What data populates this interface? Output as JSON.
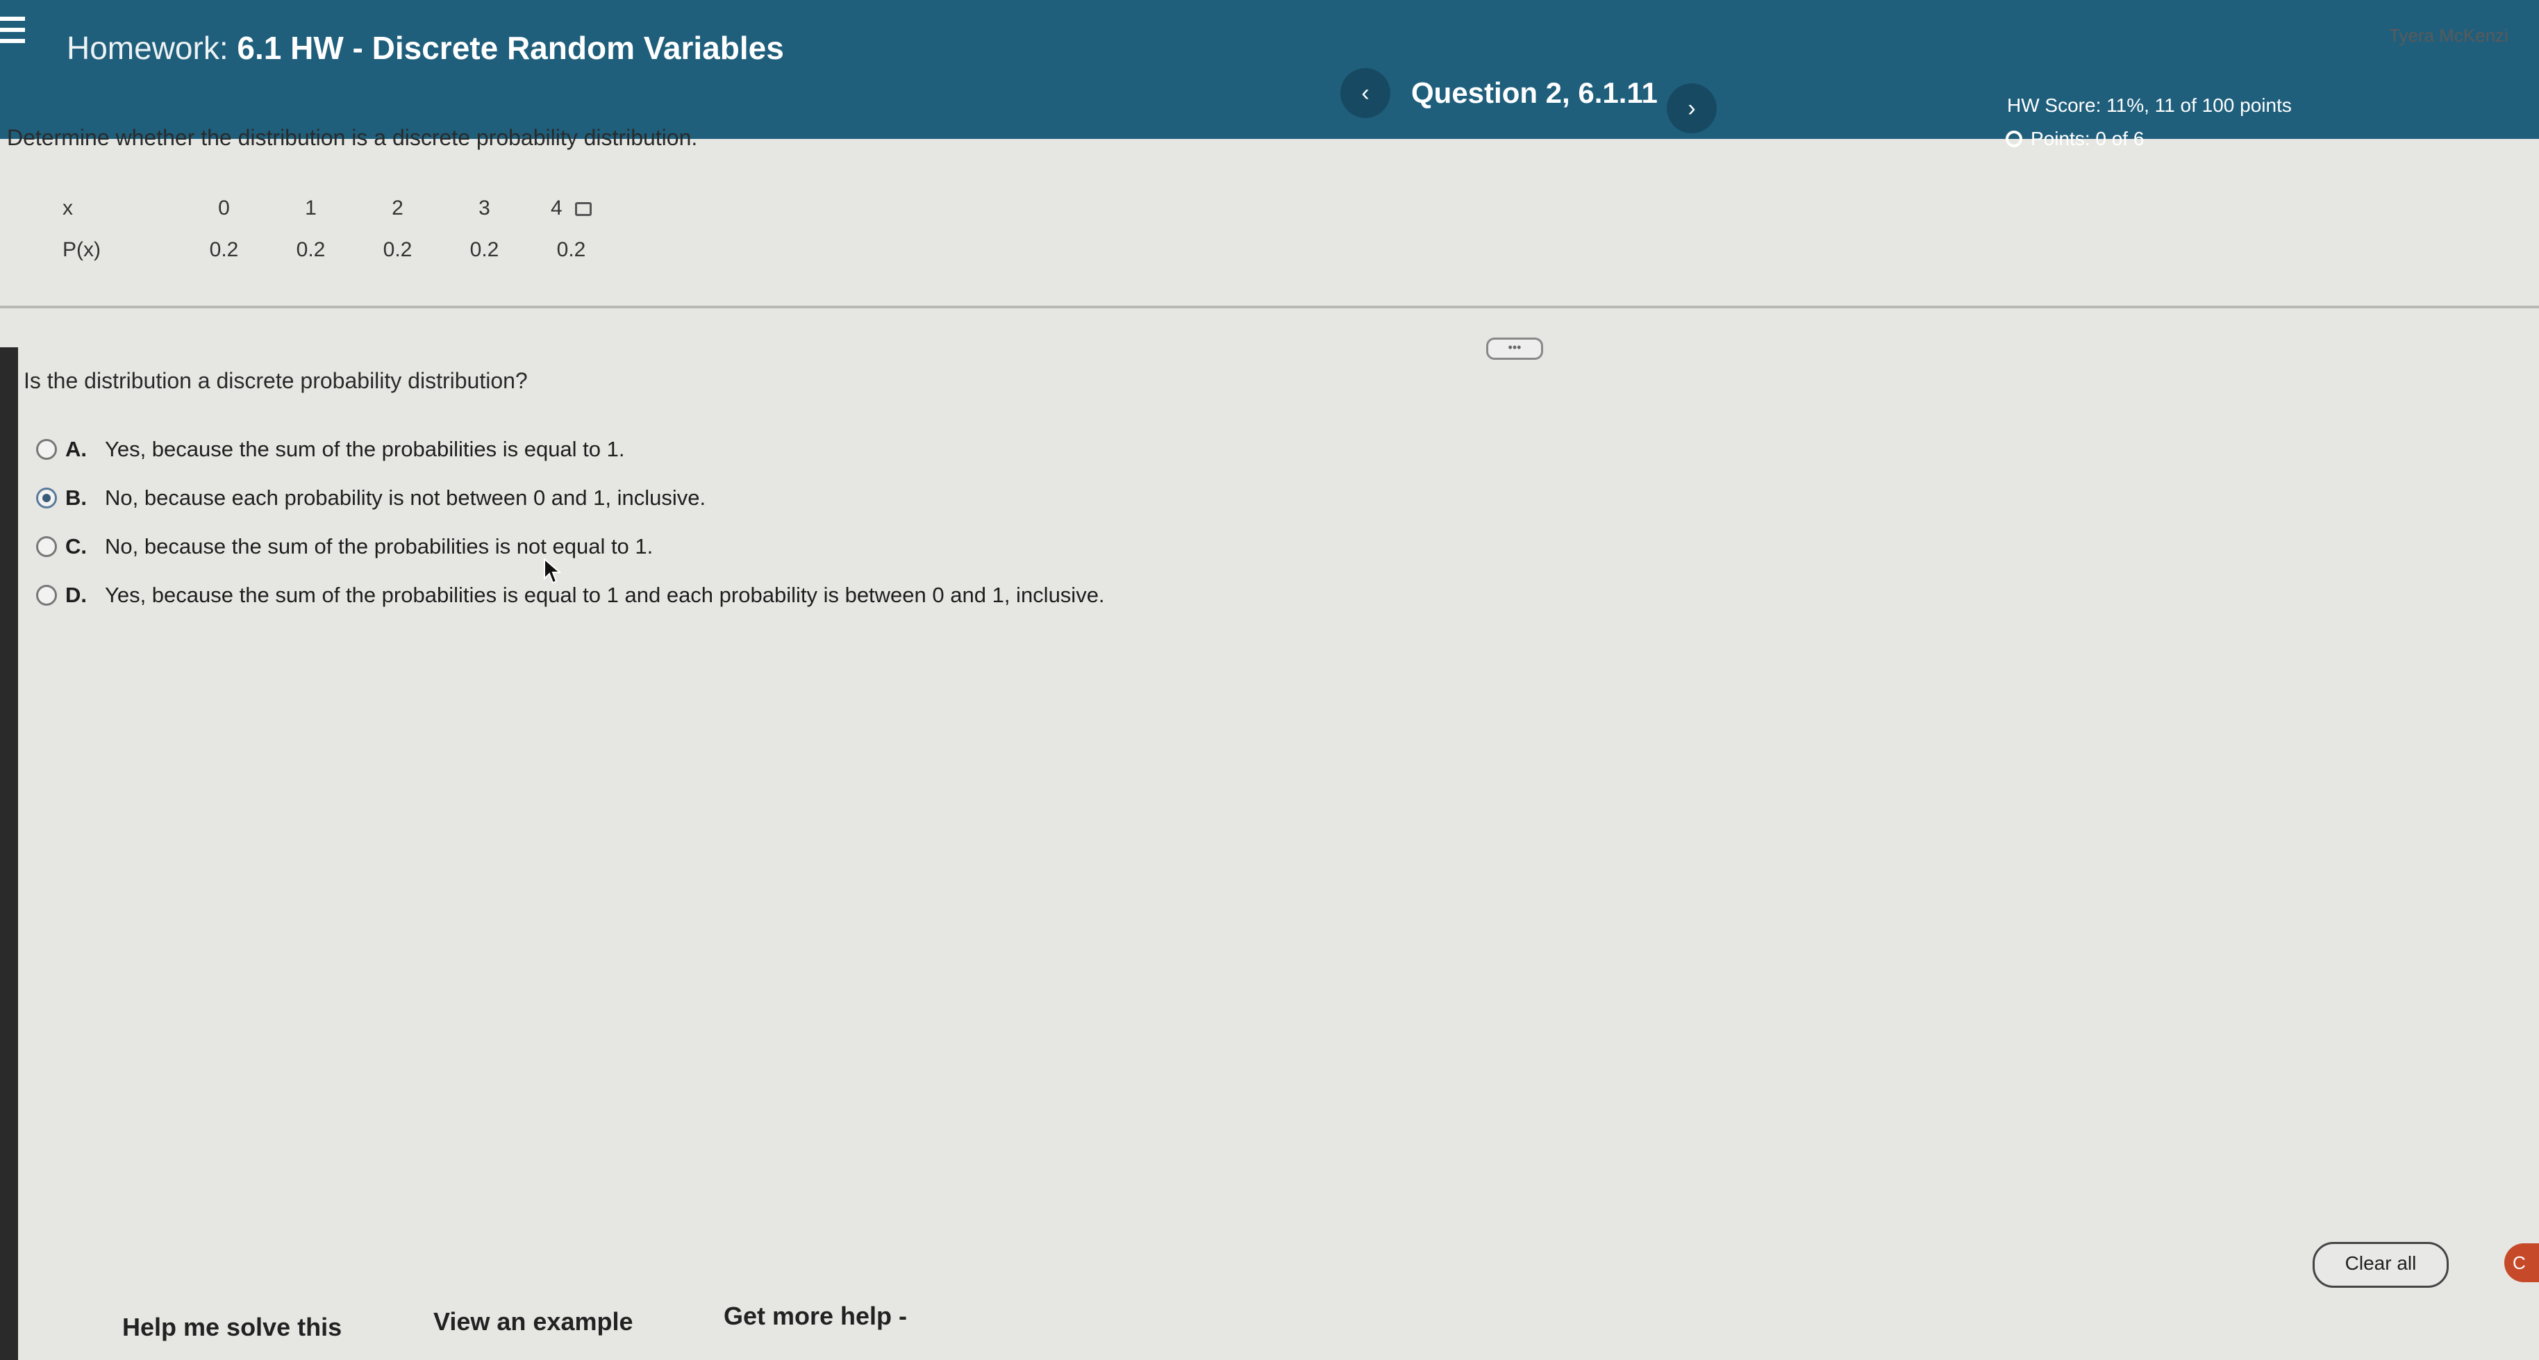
{
  "header": {
    "title_prefix": "Homework:",
    "title": "6.1 HW - Discrete Random Variables",
    "question_label": "Question 2, 6.1.11",
    "prev_symbol": "‹",
    "next_symbol": "›",
    "hw_score": "HW Score: 11%, 11 of 100 points",
    "points": "Points: 0 of 6",
    "user_name": "Tyera McKenzi"
  },
  "problem": {
    "instructions": "Determine whether the distribution is a discrete probability distribution.",
    "table": {
      "x_header": "x",
      "px_header": "P(x)",
      "x_values": [
        "0",
        "1",
        "2",
        "3",
        "4"
      ],
      "p_values": [
        "0.2",
        "0.2",
        "0.2",
        "0.2",
        "0.2"
      ]
    },
    "expand_handle": "•••",
    "question": "Is the distribution a discrete probability distribution?",
    "options": [
      {
        "letter": "A.",
        "text": "Yes, because the sum of the probabilities is equal to 1.",
        "selected": false
      },
      {
        "letter": "B.",
        "text": "No, because each probability is not between 0 and 1, inclusive.",
        "selected": true
      },
      {
        "letter": "C.",
        "text": "No, because the sum of the probabilities is not equal to 1.",
        "selected": false
      },
      {
        "letter": "D.",
        "text": "Yes, because the sum of the probabilities is equal to 1 and each probability is between 0 and 1, inclusive.",
        "selected": false
      }
    ]
  },
  "footer": {
    "help_me_solve": "Help me solve this",
    "view_example": "View an example",
    "get_more_help": "Get more help -",
    "clear_all": "Clear all",
    "check_answer": "C"
  },
  "colors": {
    "header_bg": "#1f5f7c",
    "page_bg": "#e6e6e3",
    "check_answer_bg": "#c64a2a"
  }
}
